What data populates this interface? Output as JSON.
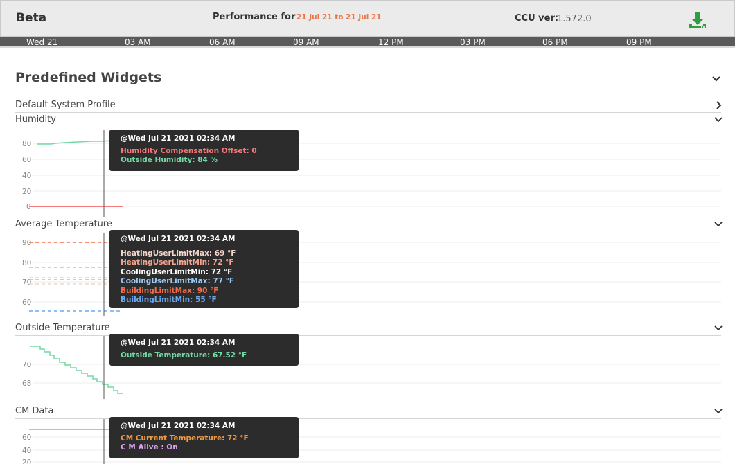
{
  "header": {
    "brand": "Beta",
    "performance_label": "Performance for",
    "date_range": "21 Jul 21 to 21 Jul 21",
    "ccu_label": "CCU ver:",
    "ccu_version": "1.572.0"
  },
  "timeline": {
    "ticks": [
      "Wed 21",
      "03 AM",
      "06 AM",
      "09 AM",
      "12 PM",
      "03 PM",
      "06 PM",
      "09 PM"
    ]
  },
  "section": {
    "title": "Predefined Widgets"
  },
  "profile": {
    "label": "Default System Profile"
  },
  "widgets": {
    "humidity": {
      "label": "Humidity",
      "yticks": [
        "80",
        "60",
        "40",
        "20",
        "0"
      ],
      "tooltip": {
        "timestamp": "@Wed Jul 21 2021 02:34 AM",
        "lines": [
          "Humidity Compensation Offset: 0",
          "Outside Humidity: 84 %"
        ],
        "colors": [
          "#f47a7a",
          "#73d9a4"
        ]
      }
    },
    "avg_temp": {
      "label": "Average Temperature",
      "yticks": [
        "90",
        "80",
        "70",
        "60"
      ],
      "tooltip": {
        "timestamp": "@Wed Jul 21 2021 02:34 AM",
        "lines": [
          "HeatingUserLimitMax: 69 °F",
          "HeatingUserLimitMin: 72 °F",
          "CoolingUserLimitMin: 72 °F",
          "CoolingUserLimitMax: 77 °F",
          "BuildingLimitMax: 90 °F",
          "BuildingLimitMin: 55 °F"
        ],
        "colors": [
          "#f4d6cc",
          "#f4a58f",
          "#ffffff",
          "#9cc9f2",
          "#f06d4d",
          "#6aa8ee"
        ]
      }
    },
    "outside_temp": {
      "label": "Outside Temperature",
      "yticks": [
        "70",
        "68"
      ],
      "tooltip": {
        "timestamp": "@Wed Jul 21 2021 02:34 AM",
        "lines": [
          "Outside Temperature: 67.52 °F"
        ],
        "colors": [
          "#73d9a4"
        ]
      }
    },
    "cm_data": {
      "label": "CM Data",
      "yticks": [
        "60",
        "40",
        "20"
      ],
      "tooltip": {
        "timestamp": "@Wed Jul 21 2021 02:34 AM",
        "lines": [
          "CM Current Temperature: 72 °F",
          "C M Alive : On"
        ],
        "colors": [
          "#f39a3e",
          "#d9a0e8"
        ]
      }
    }
  },
  "colors": {
    "accent_orange": "#e8774a",
    "download_green": "#2e9e3f",
    "header_bg": "#ebebeb",
    "timeline_bg": "#5a5a5a"
  },
  "icons": {
    "download": "download-icon",
    "chevron_down": "chevron-down-icon",
    "chevron_right": "chevron-right-icon"
  }
}
